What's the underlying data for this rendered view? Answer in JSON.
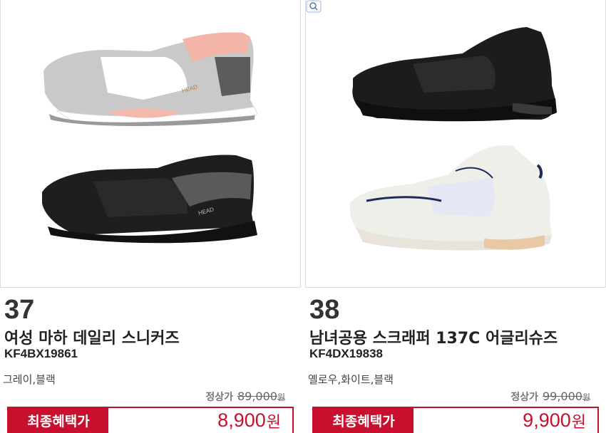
{
  "products": [
    {
      "number": "37",
      "title": "여성 마하 데일리 스니커즈",
      "code": "KF4BX19861",
      "colors": "그레이,블랙",
      "regular_label": "정상가",
      "regular_price": "89,000",
      "regular_unit": "원",
      "final_label": "최종혜택가",
      "final_price": "8,900",
      "final_unit": "원",
      "brand_mark": "HEAD"
    },
    {
      "number": "38",
      "title": "남녀공용 스크래퍼 137C 어글리슈즈",
      "code": "KF4DX19838",
      "colors": "옐로우,화이트,블랙",
      "regular_label": "정상가",
      "regular_price": "99,000",
      "regular_unit": "원",
      "final_label": "최종혜택가",
      "final_price": "9,900",
      "final_unit": "원"
    }
  ],
  "colors": {
    "accent": "#c8102e"
  },
  "icons": {
    "zoom": "zoom-icon"
  }
}
